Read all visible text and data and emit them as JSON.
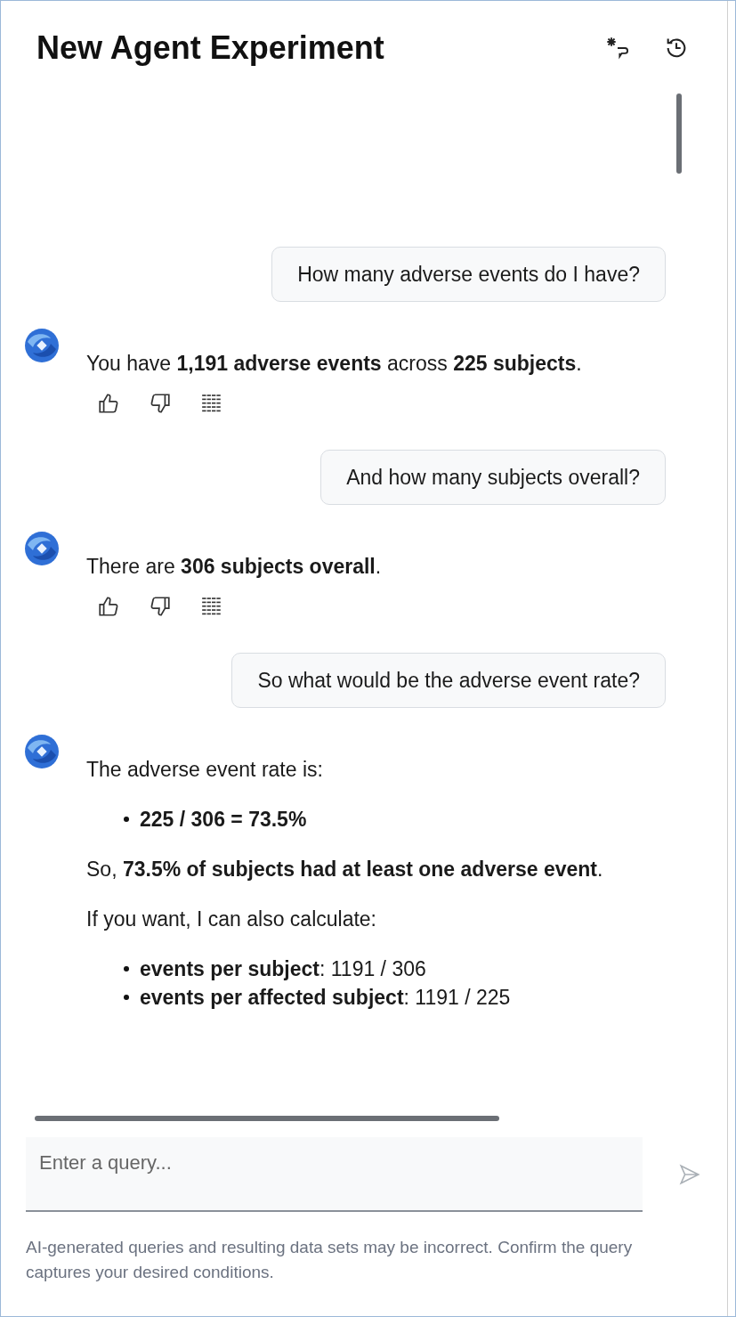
{
  "title": "New Agent Experiment",
  "messages": [
    {
      "kind": "user",
      "text": "How many adverse events do I have?"
    },
    {
      "kind": "assistant",
      "feedback": true,
      "blocks": [
        {
          "kind": "paragraph",
          "text": "You have **1,191 adverse events** across **225 subjects**."
        }
      ]
    },
    {
      "kind": "user",
      "text": "And how many subjects overall?"
    },
    {
      "kind": "assistant",
      "feedback": true,
      "blocks": [
        {
          "kind": "paragraph",
          "text": "There are **306 subjects overall**."
        }
      ]
    },
    {
      "kind": "user",
      "text": "So what would be the adverse event rate?"
    },
    {
      "kind": "assistant",
      "feedback": false,
      "blocks": [
        {
          "kind": "paragraph",
          "text": "The adverse event rate is:"
        },
        {
          "kind": "bullets",
          "items": [
            "**225 / 306 = 73.5%**"
          ]
        },
        {
          "kind": "paragraph",
          "text": "So, **73.5% of subjects had at least one adverse event**."
        },
        {
          "kind": "paragraph",
          "text": "If you want, I can also calculate:"
        },
        {
          "kind": "bullets",
          "items": [
            "**events per subject**: 1191 / 306",
            "**events per affected subject**: 1191 / 225"
          ]
        }
      ]
    }
  ],
  "query": {
    "placeholder": "Enter a query..."
  },
  "disclaimer": "AI-generated queries and resulting data sets may be incorrect. Confirm the query captures your desired conditions."
}
